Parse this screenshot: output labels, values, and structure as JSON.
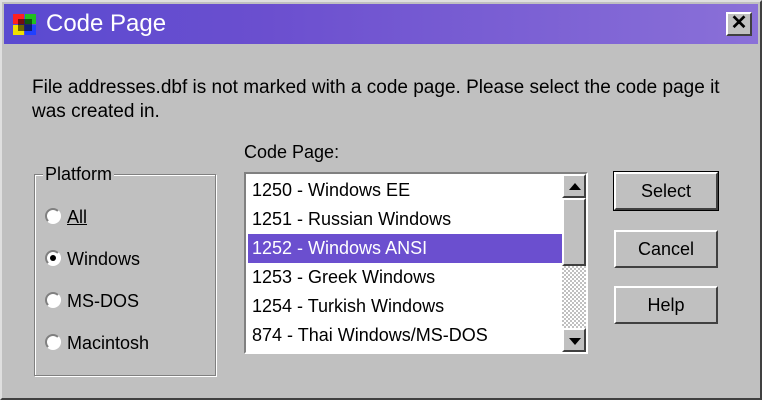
{
  "window": {
    "title": "Code Page",
    "close_glyph": "✕"
  },
  "message": "File addresses.dbf is not marked with a code page.  Please select the code page it was created in.",
  "platform": {
    "legend": "Platform",
    "options": [
      {
        "label": "All",
        "selected": false
      },
      {
        "label": "Windows",
        "selected": true
      },
      {
        "label": "MS-DOS",
        "selected": false
      },
      {
        "label": "Macintosh",
        "selected": false
      }
    ]
  },
  "code_page": {
    "label": "Code Page:",
    "items": [
      "1250 - Windows EE",
      "1251 - Russian Windows",
      "1252 - Windows ANSI",
      "1253 - Greek Windows",
      "1254 - Turkish Windows",
      "874 - Thai Windows/MS-DOS"
    ],
    "selected_index": 2
  },
  "buttons": {
    "select": "Select",
    "cancel": "Cancel",
    "help": "Help"
  },
  "colors": {
    "title_bar": "#6b4fcf",
    "selection": "#6b4fcf",
    "face": "#c0c0c0"
  }
}
